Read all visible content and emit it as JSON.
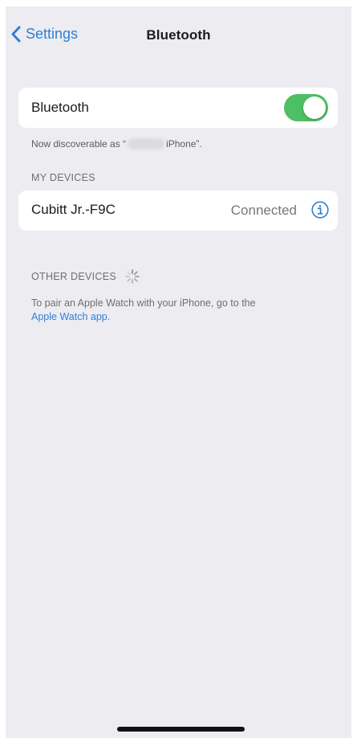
{
  "nav": {
    "back_label": "Settings",
    "title": "Bluetooth"
  },
  "bluetooth": {
    "label": "Bluetooth",
    "enabled": true,
    "toggle_color": "#4fbf65",
    "discoverable_prefix": "Now discoverable as “",
    "discoverable_suffix": "iPhone”."
  },
  "my_devices": {
    "header": "MY DEVICES",
    "devices": [
      {
        "name": "Cubitt Jr.-F9C",
        "status": "Connected",
        "icon": "info-icon"
      }
    ]
  },
  "other_devices": {
    "header": "OTHER DEVICES",
    "spinner_icon": "loading-spinner-icon",
    "pair_text": "To pair an Apple Watch with your iPhone, go to the",
    "pair_link": "Apple Watch app."
  },
  "colors": {
    "accent": "#2f7fd3",
    "background": "#ececf1"
  }
}
